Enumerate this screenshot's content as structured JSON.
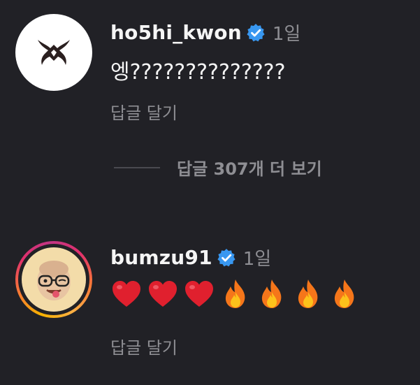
{
  "comments": [
    {
      "username": "ho5hi_kwon",
      "time": "1일",
      "text": "엥??????????????",
      "reply_label": "답글 달기",
      "avatar_icon": "tribal-logo-icon",
      "verified_icon": "verified-badge-icon"
    },
    {
      "username": "bumzu91",
      "time": "1일",
      "emojis": [
        "heart-icon",
        "heart-icon",
        "heart-icon",
        "fire-icon",
        "fire-icon",
        "fire-icon",
        "fire-icon"
      ],
      "reply_label": "답글 달기",
      "avatar_icon": "memoji-avatar-icon",
      "verified_icon": "verified-badge-icon"
    }
  ],
  "more_replies_label": "답글 307개 더 보기",
  "colors": {
    "background": "#212126",
    "verified_blue": "#3897f0",
    "muted_text": "#8e8e93",
    "heart_red": "#e0202e",
    "fire_orange": "#f5761a"
  }
}
